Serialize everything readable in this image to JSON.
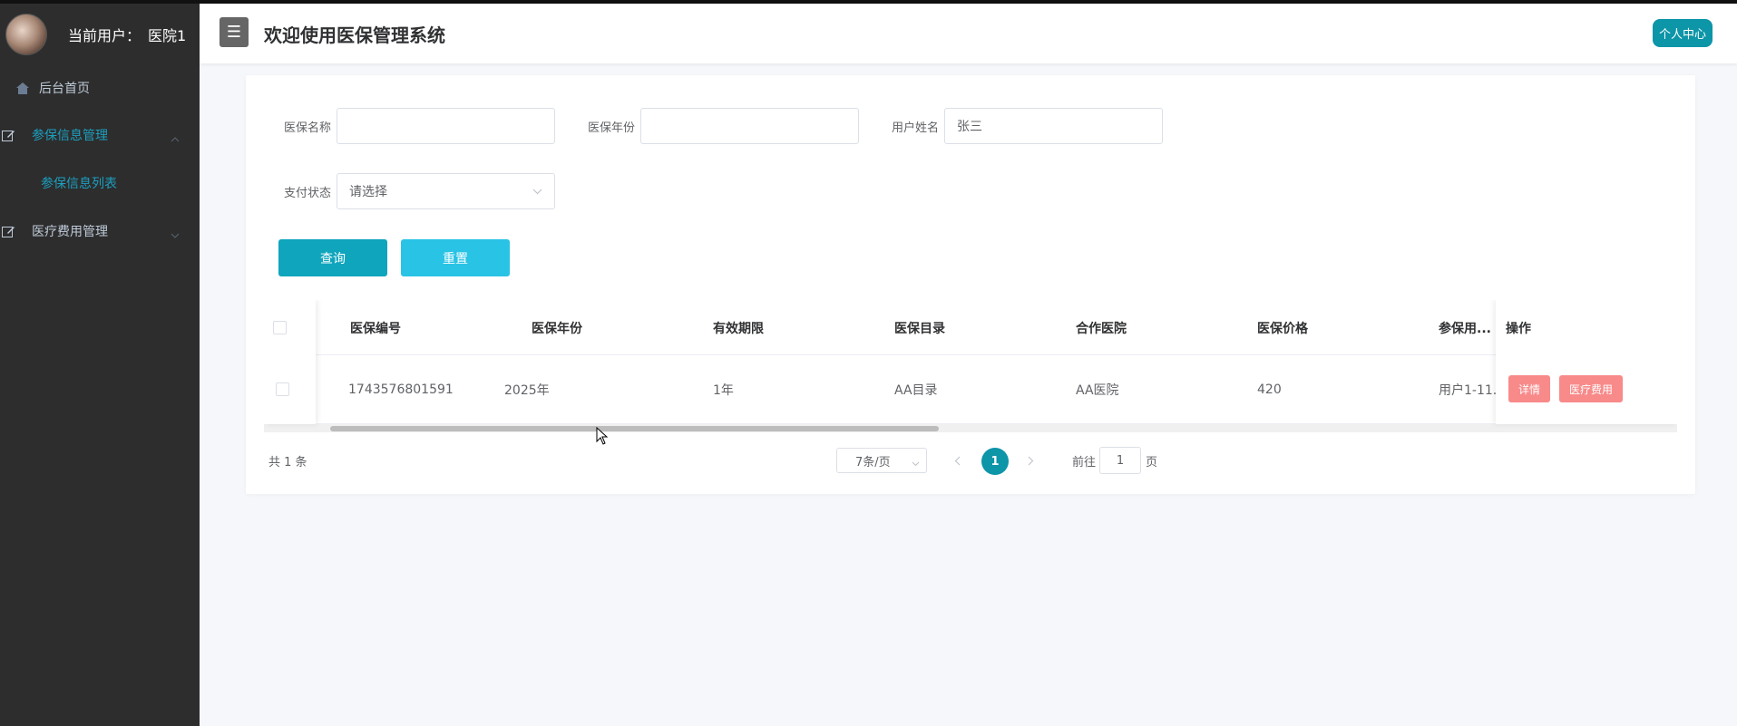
{
  "sidebar": {
    "user_label": "当前用户：",
    "user_name": "医院1",
    "home": "后台首页",
    "groups": [
      {
        "label": "参保信息管理",
        "expanded": true,
        "children": [
          "参保信息列表"
        ]
      },
      {
        "label": "医疗费用管理",
        "expanded": false
      }
    ]
  },
  "header": {
    "title": "欢迎使用医保管理系统",
    "profile_button": "个人中心"
  },
  "filters": {
    "name_label": "医保名称",
    "name_value": "",
    "year_label": "医保年份",
    "year_value": "",
    "user_label": "用户姓名",
    "user_value": "张三",
    "status_label": "支付状态",
    "status_placeholder": "请选择",
    "search_button": "查询",
    "reset_button": "重置"
  },
  "table": {
    "columns": [
      "医保编号",
      "医保年份",
      "有效期限",
      "医保目录",
      "合作医院",
      "医保价格",
      "参保用..."
    ],
    "op_column": "操作",
    "rows": [
      {
        "cells": [
          "1743576801591",
          "2025年",
          "1年",
          "AA目录",
          "AA医院",
          "420",
          "用户1-11..."
        ],
        "actions": [
          "详情",
          "医疗费用"
        ]
      }
    ]
  },
  "pagination": {
    "total": "共 1 条",
    "page_size": "7条/页",
    "current_page": "1",
    "goto_prefix": "前往",
    "goto_value": "1",
    "goto_suffix": "页"
  },
  "colors": {
    "sidebar_bg": "#2d2d2d",
    "accent": "#0d95a8",
    "active_menu": "#1c9fbf",
    "search_button": "#0ea5bd",
    "reset_button": "#29c3e5",
    "action_button": "#f88a8a"
  }
}
